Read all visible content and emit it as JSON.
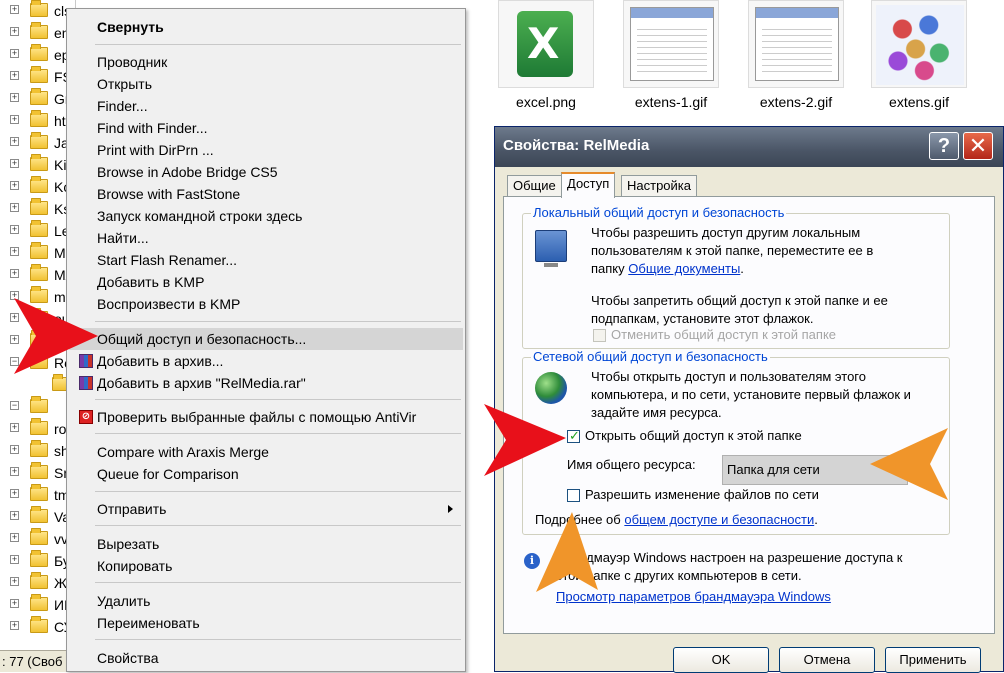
{
  "tree": {
    "items": [
      {
        "label": "cls",
        "expander": "+"
      },
      {
        "label": "en",
        "expander": "+"
      },
      {
        "label": "ep",
        "expander": "+"
      },
      {
        "label": "FS",
        "expander": "+"
      },
      {
        "label": "Gr",
        "expander": "+"
      },
      {
        "label": "htr",
        "expander": "+"
      },
      {
        "label": "Ja",
        "expander": "+"
      },
      {
        "label": "Kir",
        "expander": "+"
      },
      {
        "label": "Ko",
        "expander": "+"
      },
      {
        "label": "Ks",
        "expander": "+"
      },
      {
        "label": "Le",
        "expander": "+"
      },
      {
        "label": "Ma",
        "expander": "+"
      },
      {
        "label": "MA",
        "expander": "+"
      },
      {
        "label": "mu",
        "expander": "+"
      },
      {
        "label": "ou",
        "expander": "+"
      },
      {
        "label": "",
        "expander": "+"
      },
      {
        "label": "Re",
        "expander": "−"
      },
      {
        "label": "",
        "expander": ""
      },
      {
        "label": "",
        "expander": "−"
      },
      {
        "label": "ro",
        "expander": "+"
      },
      {
        "label": "sh",
        "expander": "+"
      },
      {
        "label": "Sn",
        "expander": "+"
      },
      {
        "label": "tm",
        "expander": "+"
      },
      {
        "label": "Va",
        "expander": "+"
      },
      {
        "label": "vv",
        "expander": "+"
      },
      {
        "label": "Бу",
        "expander": "+"
      },
      {
        "label": "Же",
        "expander": "+"
      },
      {
        "label": "ИК",
        "expander": "+"
      },
      {
        "label": "СУ",
        "expander": "+"
      }
    ],
    "status": ": 77 (Своб"
  },
  "thumbnails": [
    {
      "label": "excel.png",
      "icon": "excel-icon"
    },
    {
      "label": "extens-1.gif",
      "icon": "screenshot-thumb-icon"
    },
    {
      "label": "extens-2.gif",
      "icon": "screenshot-thumb-icon"
    },
    {
      "label": "extens.gif",
      "icon": "cubes-icon"
    }
  ],
  "context_menu": {
    "items": [
      {
        "label": "Свернуть",
        "bold": true
      },
      {
        "label": "Проводник"
      },
      {
        "label": "Открыть"
      },
      {
        "label": "Finder..."
      },
      {
        "label": "Find with Finder..."
      },
      {
        "label": "Print with DirPrn ..."
      },
      {
        "label": "Browse in Adobe Bridge CS5"
      },
      {
        "label": "Browse with FastStone"
      },
      {
        "label": "Запуск командной строки здесь"
      },
      {
        "label": "Найти..."
      },
      {
        "label": "Start Flash Renamer..."
      },
      {
        "label": "Добавить в KMP"
      },
      {
        "label": "Воспроизвести в KMP"
      },
      {
        "label": "Общий доступ и безопасность...",
        "highlight": true
      },
      {
        "label": "Добавить в архив...",
        "icon": "winrar-icon"
      },
      {
        "label": "Добавить в архив \"RelMedia.rar\"",
        "icon": "winrar-icon"
      },
      {
        "label": "Проверить выбранные файлы с помощью AntiVir",
        "icon": "antivir-icon"
      },
      {
        "label": "Compare with Araxis Merge"
      },
      {
        "label": "Queue for Comparison"
      },
      {
        "label": "Отправить",
        "submenu": true
      },
      {
        "label": "Вырезать"
      },
      {
        "label": "Копировать"
      },
      {
        "label": "Удалить"
      },
      {
        "label": "Переименовать"
      },
      {
        "label": "Свойства"
      }
    ]
  },
  "dialog": {
    "title": "Свойства: RelMedia",
    "help_label": "?",
    "close_label": "✕",
    "tabs": [
      {
        "label": "Общие",
        "active": false
      },
      {
        "label": "Доступ",
        "active": true
      },
      {
        "label": "Настройка",
        "active": false
      }
    ],
    "local": {
      "title": "Локальный общий доступ и безопасность",
      "text1_line1": "Чтобы разрешить доступ другим локальным",
      "text1_line2": "пользователям к этой папке, переместите ее в",
      "text1_line3_prefix": "папку",
      "text1_link": "Общие документы",
      "text1_line3_suffix": ".",
      "text2_line1": "Чтобы запретить общий доступ к этой папке и ее",
      "text2_line2": "подпапкам, установите этот флажок.",
      "checkbox_label": "Отменить общий доступ к этой папке",
      "checkbox_checked": false
    },
    "network": {
      "title": "Сетевой общий доступ и безопасность",
      "text_line1": "Чтобы открыть доступ и пользователям этого",
      "text_line2": "компьютера, и по сети, установите первый флажок и",
      "text_line3": "задайте имя ресурса.",
      "share_checkbox_label": "Открыть общий доступ к этой папке",
      "share_checked": true,
      "share_name_label": "Имя общего ресурса:",
      "share_name_value": "Папка для сети",
      "allow_change_label": "Разрешить изменение файлов по сети",
      "allow_change_checked": false,
      "more_prefix": "Подробнее об",
      "more_link": "общем доступе и безопасности",
      "more_suffix": "."
    },
    "firewall": {
      "line1": "Брандмауэр Windows настроен на разрешение доступа к",
      "line2": "этой папке с других компьютеров в сети.",
      "link": "Просмотр параметров брандмауэра Windows"
    },
    "buttons": {
      "ok": "OK",
      "cancel": "Отмена",
      "apply": "Применить"
    }
  }
}
